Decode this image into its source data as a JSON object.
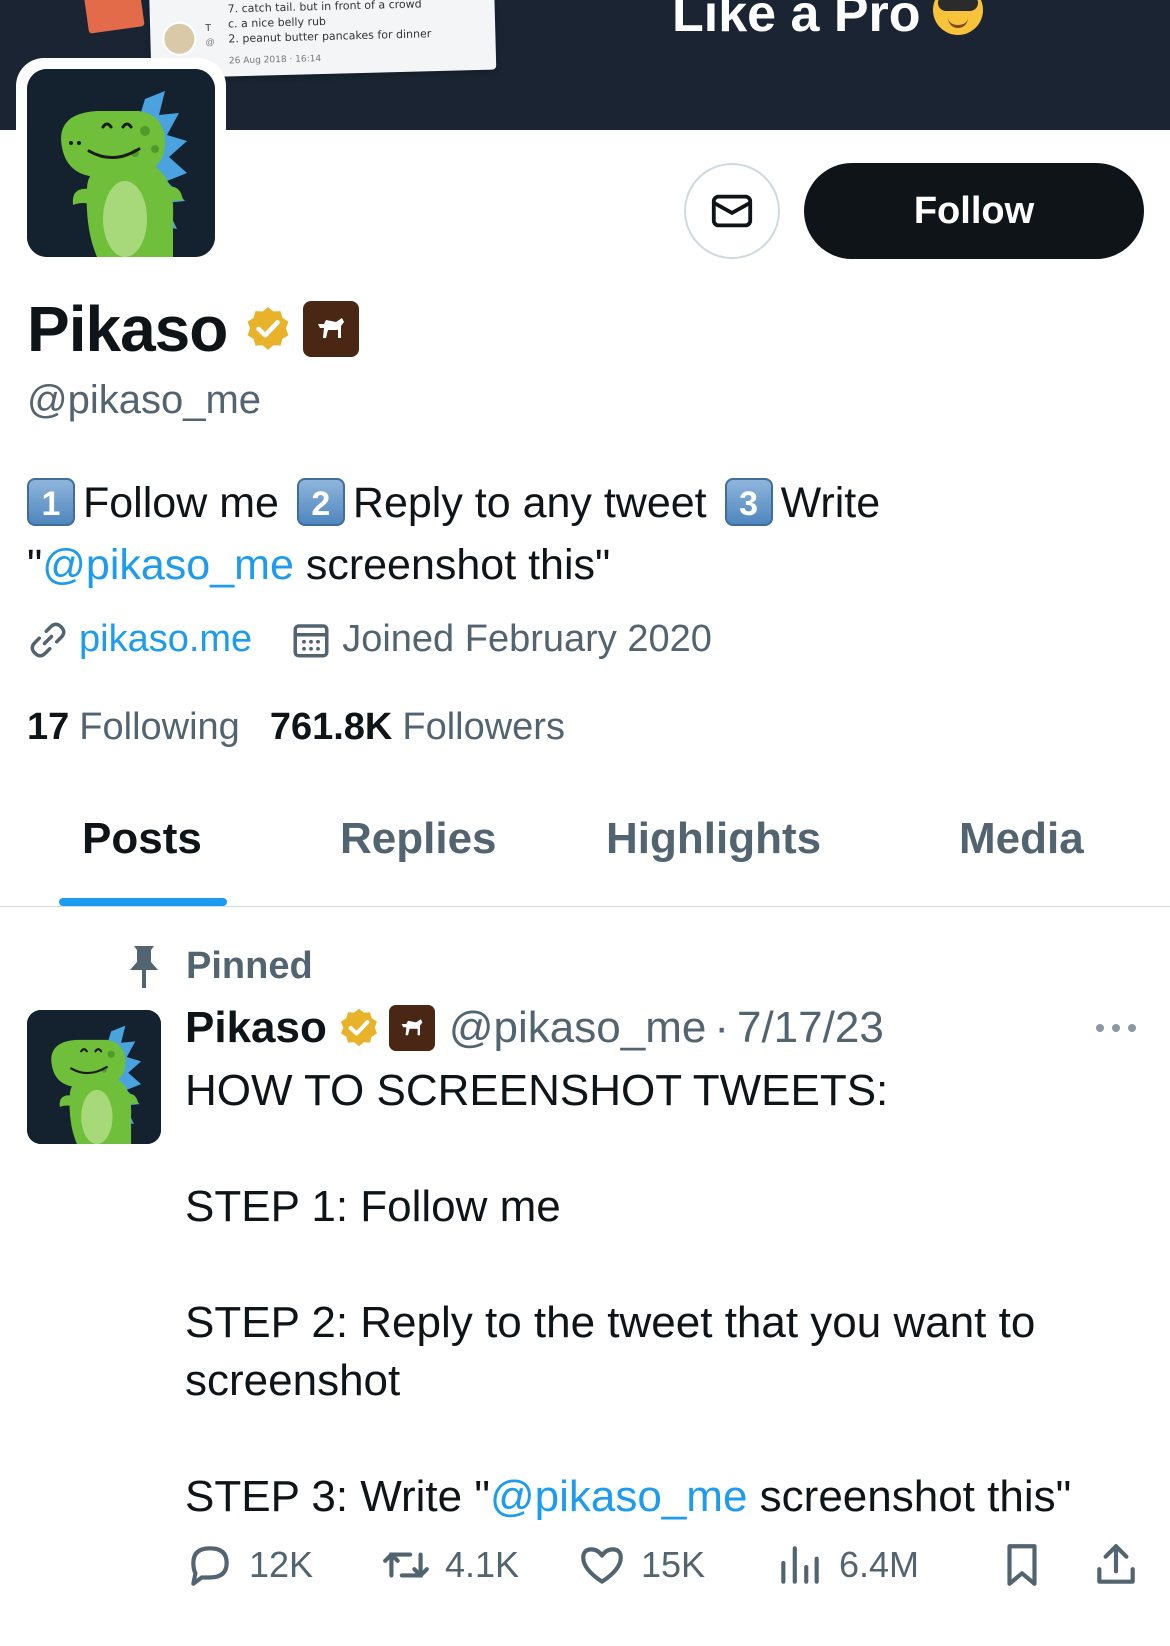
{
  "banner": {
    "headline": "Like a Pro",
    "card_line_1": "7. catch tail. but in front of a crowd",
    "card_line_2": "c. a nice belly rub",
    "card_line_3": "2. peanut butter pancakes for dinner",
    "card_date": "26 Aug 2018 · 16:14",
    "card_letter": "T",
    "card_at": "@"
  },
  "profile": {
    "name": "Pikaso",
    "handle": "@pikaso_me",
    "bio": {
      "key1": "1",
      "text1": "Follow me",
      "key2": "2",
      "text2": "Reply to any tweet",
      "key3": "3",
      "text3": "Write",
      "quote_open": "\"",
      "mention": "@pikaso_me",
      "text4": " screenshot this\""
    },
    "website": "pikaso.me",
    "joined": "Joined February 2020",
    "following_count": "17",
    "following_label": "Following",
    "followers_count": "761.8K",
    "followers_label": "Followers"
  },
  "actions": {
    "follow_label": "Follow"
  },
  "tabs": [
    {
      "label": "Posts",
      "active": true
    },
    {
      "label": "Replies",
      "active": false
    },
    {
      "label": "Highlights",
      "active": false
    },
    {
      "label": "Media",
      "active": false
    }
  ],
  "pinned_tweet": {
    "pinned_label": "Pinned",
    "name": "Pikaso",
    "handle": "@pikaso_me",
    "separator": "·",
    "date": "7/17/23",
    "line1": "HOW TO SCREENSHOT TWEETS:",
    "line2": "STEP 1: Follow me",
    "line3": "STEP 2: Reply to the tweet that you want to screenshot",
    "line4_prefix": "STEP 3: Write \"",
    "line4_mention": "@pikaso_me",
    "line4_suffix": " screenshot this\"",
    "replies": "12K",
    "retweets": "4.1K",
    "likes": "15K",
    "views": "6.4M"
  },
  "colors": {
    "accent": "#1d9bf0",
    "text_primary": "#0f1419",
    "text_secondary": "#536471",
    "banner": "#1a2432",
    "verified_gold": "#e8b32a",
    "affiliate_badge": "#4a2614"
  },
  "icons": [
    "message-icon",
    "verified-badge-icon",
    "horse-badge-icon",
    "link-icon",
    "calendar-icon",
    "pin-icon",
    "more-icon",
    "reply-icon",
    "retweet-icon",
    "like-icon",
    "views-icon",
    "bookmark-icon",
    "share-icon"
  ]
}
